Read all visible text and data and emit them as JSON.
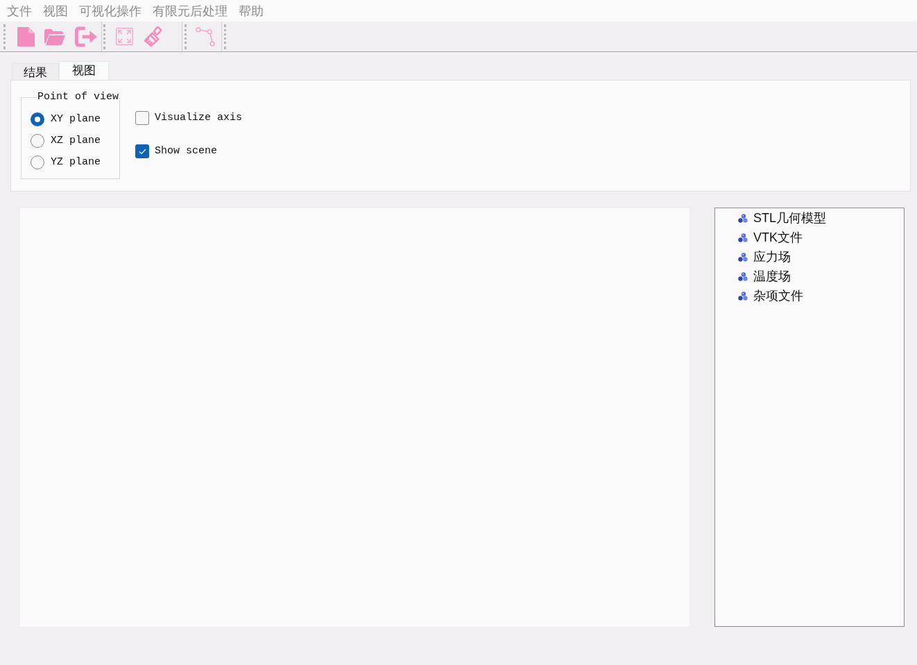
{
  "menu_bar": [
    "文件",
    "视图",
    "可视化操作",
    "有限元后处理",
    "帮助"
  ],
  "tabs": [
    {
      "label": "结果",
      "selected": false
    },
    {
      "label": "视图",
      "selected": true
    }
  ],
  "point_of_view": {
    "title": "Point of view",
    "options": [
      {
        "label": "XY plane",
        "selected": true
      },
      {
        "label": "XZ plane",
        "selected": false
      },
      {
        "label": "YZ plane",
        "selected": false
      }
    ]
  },
  "options": [
    {
      "label": "Visualize axis",
      "checked": false
    },
    {
      "label": "Show scene",
      "checked": true
    }
  ],
  "tree": {
    "items": [
      {
        "label": "STL几何模型"
      },
      {
        "label": "VTK文件"
      },
      {
        "label": "应力场"
      },
      {
        "label": "温度场"
      },
      {
        "label": "杂项文件"
      }
    ]
  }
}
